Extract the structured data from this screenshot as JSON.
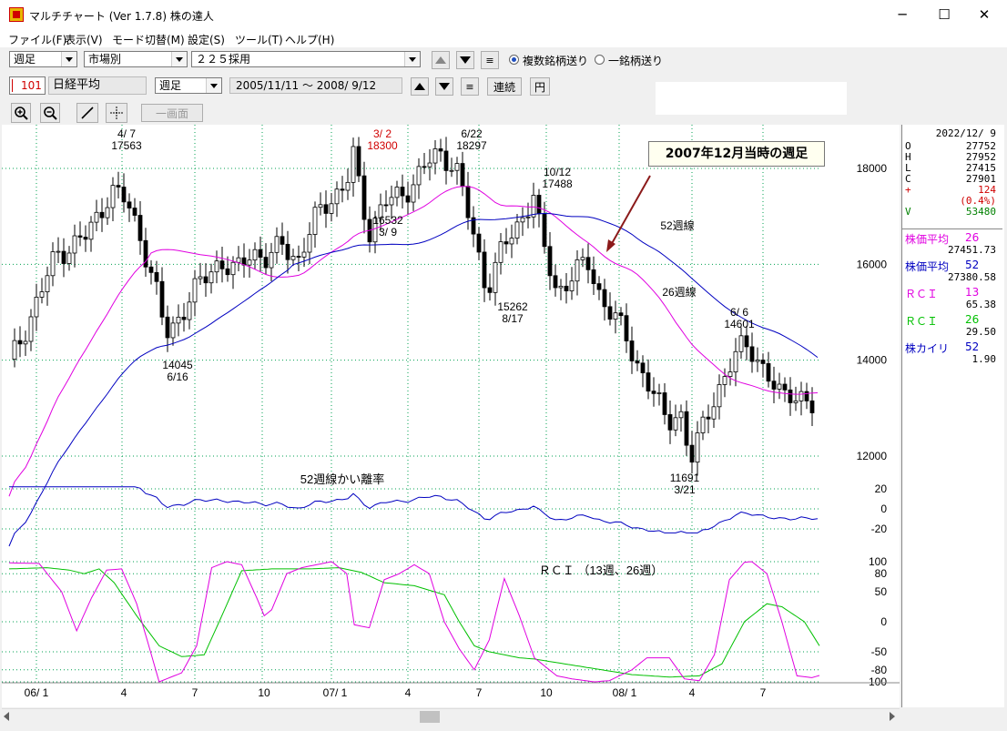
{
  "window": {
    "title": "マルチチャート (Ver 1.7.8)  株の達人",
    "buttons": {
      "minimize": "─",
      "maximize": "☐",
      "close": "✕"
    }
  },
  "menu": [
    "ファイル(F)",
    "表示(V)",
    "モード切替(M)",
    "設定(S)",
    "ツール(T)",
    "ヘルプ(H)"
  ],
  "toolbar1": {
    "period": "週足",
    "market": "市場別",
    "group": "２２５採用",
    "list_btn": "≡",
    "radio_multi": "複数銘柄送り",
    "radio_single": "一銘柄送り"
  },
  "toolbar2": {
    "code": "101",
    "name": "日経平均",
    "period": "週足",
    "range": "2005/11/11 ～  2008/ 9/12",
    "list_btn": "≡",
    "renzoku": "連続",
    "yen": "円"
  },
  "toolbar3": {
    "one_screen": "一画面"
  },
  "chart": {
    "annotation_box": "2007年12月当時の週足",
    "ma52_label": "52週線",
    "ma26_label": "26週線",
    "deviation_title": "52週線かい離率",
    "rci_title": "ＲＣＩ （13週、26週）",
    "price_labels": [
      {
        "value": "4/ 7",
        "sub": "17563"
      },
      {
        "value": "3/ 2",
        "sub": "18300"
      },
      {
        "value": "6/22",
        "sub": "18297"
      },
      {
        "value": "10/12",
        "sub": "17488"
      },
      {
        "value": "14045",
        "sub": "6/16"
      },
      {
        "value": "16532",
        "sub": "3/ 9"
      },
      {
        "value": "15262",
        "sub": "8/17"
      },
      {
        "value": "6/ 6",
        "sub": "14601"
      },
      {
        "value": "11691",
        "sub": "3/21"
      }
    ],
    "price_axis": [
      "18000",
      "16000",
      "14000",
      "12000"
    ],
    "dev_axis": [
      "20",
      "0",
      "-20"
    ],
    "rci_axis": [
      "100",
      "80",
      "50",
      "0",
      "-50",
      "-80",
      "-100"
    ],
    "x_axis": [
      "06/ 1",
      "4",
      "7",
      "10",
      "07/ 1",
      "4",
      "7",
      "10",
      "08/ 1",
      "4",
      "7"
    ],
    "colors": {
      "ma26": "#e000e0",
      "ma52": "#0000c0",
      "candle": "#000000",
      "grid": "#00a050",
      "rci13": "#e000e0",
      "rci26": "#00c000",
      "accent_red": "#d00000",
      "arrow": "#8b1a1a"
    }
  },
  "side": {
    "date": "2022/12/ 9",
    "ohlc": [
      {
        "k": "O",
        "v": "27752"
      },
      {
        "k": "H",
        "v": "27952"
      },
      {
        "k": "L",
        "v": "27415"
      },
      {
        "k": "C",
        "v": "27901"
      }
    ],
    "change": {
      "k": "+",
      "v": "124"
    },
    "change_pct": "(0.4%)",
    "volume": {
      "k": "V",
      "v": "53480"
    },
    "indicators": [
      {
        "name": "株価平均",
        "param": "26",
        "value": "27451.73",
        "color": "#e000e0"
      },
      {
        "name": "株価平均",
        "param": "52",
        "value": "27380.58",
        "color": "#0000c0"
      },
      {
        "name": "ＲＣＩ",
        "param": "13",
        "value": "65.38",
        "color": "#e000e0"
      },
      {
        "name": "ＲＣＩ",
        "param": "26",
        "value": "29.50",
        "color": "#00c000"
      },
      {
        "name": "株カイリ",
        "param": "52",
        "value": "1.90",
        "color": "#0000c0"
      }
    ]
  }
}
